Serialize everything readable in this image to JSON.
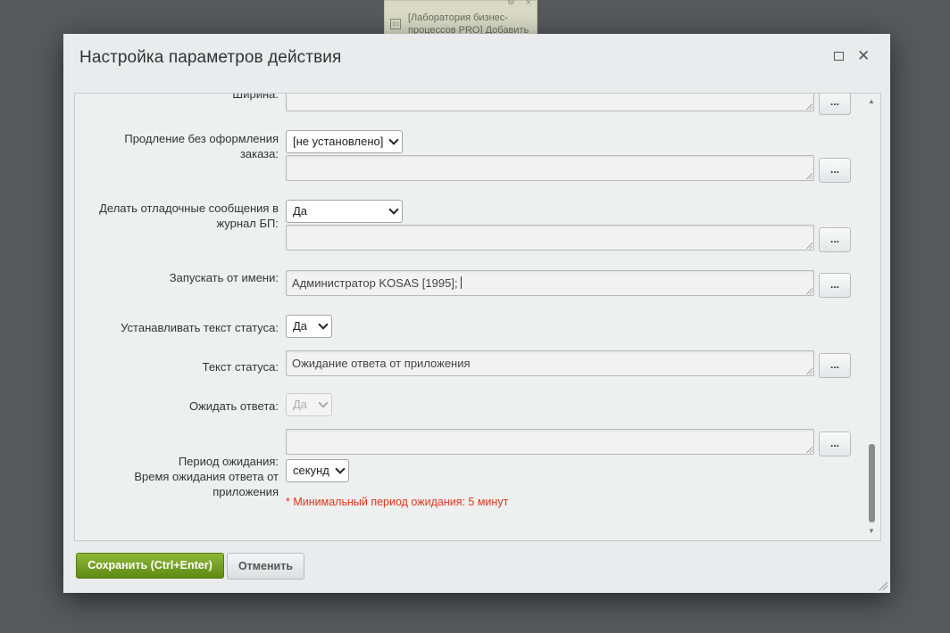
{
  "background": {
    "card_text": "[Лаборатория бизнес-процессов PRO] Добавить",
    "card_icon": "document-icon",
    "gear_icon": "⚙",
    "close_icon": "×"
  },
  "dialog": {
    "title": "Настройка параметров действия",
    "maximize_icon": "maximize-icon",
    "close_glyph": "✕"
  },
  "form": {
    "width_label": "Ширина:",
    "extension_label": "Продление без оформления заказа:",
    "extension_select": "[не установлено]",
    "debug_label": "Делать отладочные сообщения в журнал БП:",
    "debug_select": "Да",
    "run_as_label": "Запускать от имени:",
    "run_as_value": "Администратор KOSAS [1995];",
    "set_status_label": "Устанавливать текст статуса:",
    "set_status_select": "Да",
    "status_text_label": "Текст статуса:",
    "status_text_value": "Ожидание ответа от приложения",
    "wait_label": "Ожидать ответа:",
    "wait_select": "Да",
    "period_label": "Период ожидания:",
    "period_sublabel": "Время ожидания ответа от приложения",
    "period_unit_select": "секунд",
    "period_note": "* Минимальный период ожидания: 5 минут",
    "dots_label": "..."
  },
  "footer": {
    "save_label": "Сохранить (Ctrl+Enter)",
    "cancel_label": "Отменить"
  },
  "colors": {
    "save_button": "#6e9a1f",
    "note_red": "#e0341f"
  }
}
